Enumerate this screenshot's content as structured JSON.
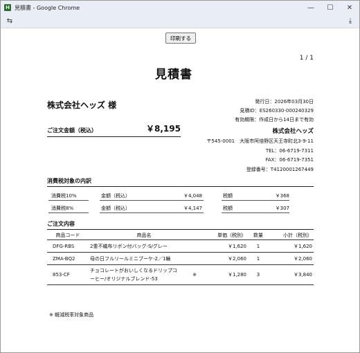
{
  "window": {
    "title": "見積書 - Google Chrome",
    "app_icon": "H",
    "minimize_glyph": "—",
    "maximize_glyph": "☐",
    "close_glyph": "✕"
  },
  "toolbar": {
    "left_icon": "⇆",
    "download_icon": "⤓"
  },
  "print_button": "印刷する",
  "page_number": "1 / 1",
  "doc_title": "見積書",
  "customer": "株式会社ヘッズ 様",
  "issue": {
    "date": "発行日：2026年03月30日",
    "id": "見積ID：ES260330-000240329",
    "validity": "有効期限：作成日から14日まで有効"
  },
  "total": {
    "label": "ご注文金額（税込）",
    "value": "￥8,195"
  },
  "company": {
    "name": "株式会社ヘッズ",
    "address": "〒545-0001　大阪市阿倍野区天王寺町北3-9-11",
    "tel": "TEL：06-6719-7311",
    "fax": "FAX：06-6719-7351",
    "registration": "登録番号：T4120001267449"
  },
  "tax_section": {
    "title": "消費税対象の内訳",
    "rows": [
      {
        "rate": "消費税10%",
        "amount_label": "金額（税込）",
        "amount": "￥4,048",
        "tax_label": "税額",
        "tax": "￥368"
      },
      {
        "rate": "消費税8%",
        "amount_label": "金額（税込）",
        "amount": "￥4,147",
        "tax_label": "税額",
        "tax": "￥307"
      }
    ]
  },
  "order_section": {
    "title": "ご注文内容",
    "headers": {
      "code": "商品コード",
      "name": "商品名",
      "price": "単価（税別）",
      "qty": "数量",
      "subtotal": "小計（税別）"
    },
    "items": [
      {
        "code": "DFG-RBS",
        "name": "2重不織布リボン付バッグ-S/グレー",
        "mark": "",
        "price": "￥1,620",
        "qty": "1",
        "subtotal": "￥1,620"
      },
      {
        "code": "ZMA-BQ2",
        "name": "母の日フルリールミニブーケ-2／1輪",
        "mark": "",
        "price": "￥2,060",
        "qty": "1",
        "subtotal": "￥2,060"
      },
      {
        "code": "853-CF",
        "name": "チョコレートがおいしくなるドリップコーヒー/オリジナルブレンド-53",
        "mark": "※",
        "price": "￥1,280",
        "qty": "3",
        "subtotal": "￥3,840"
      }
    ],
    "note": "※ 軽減税率対象商品"
  }
}
